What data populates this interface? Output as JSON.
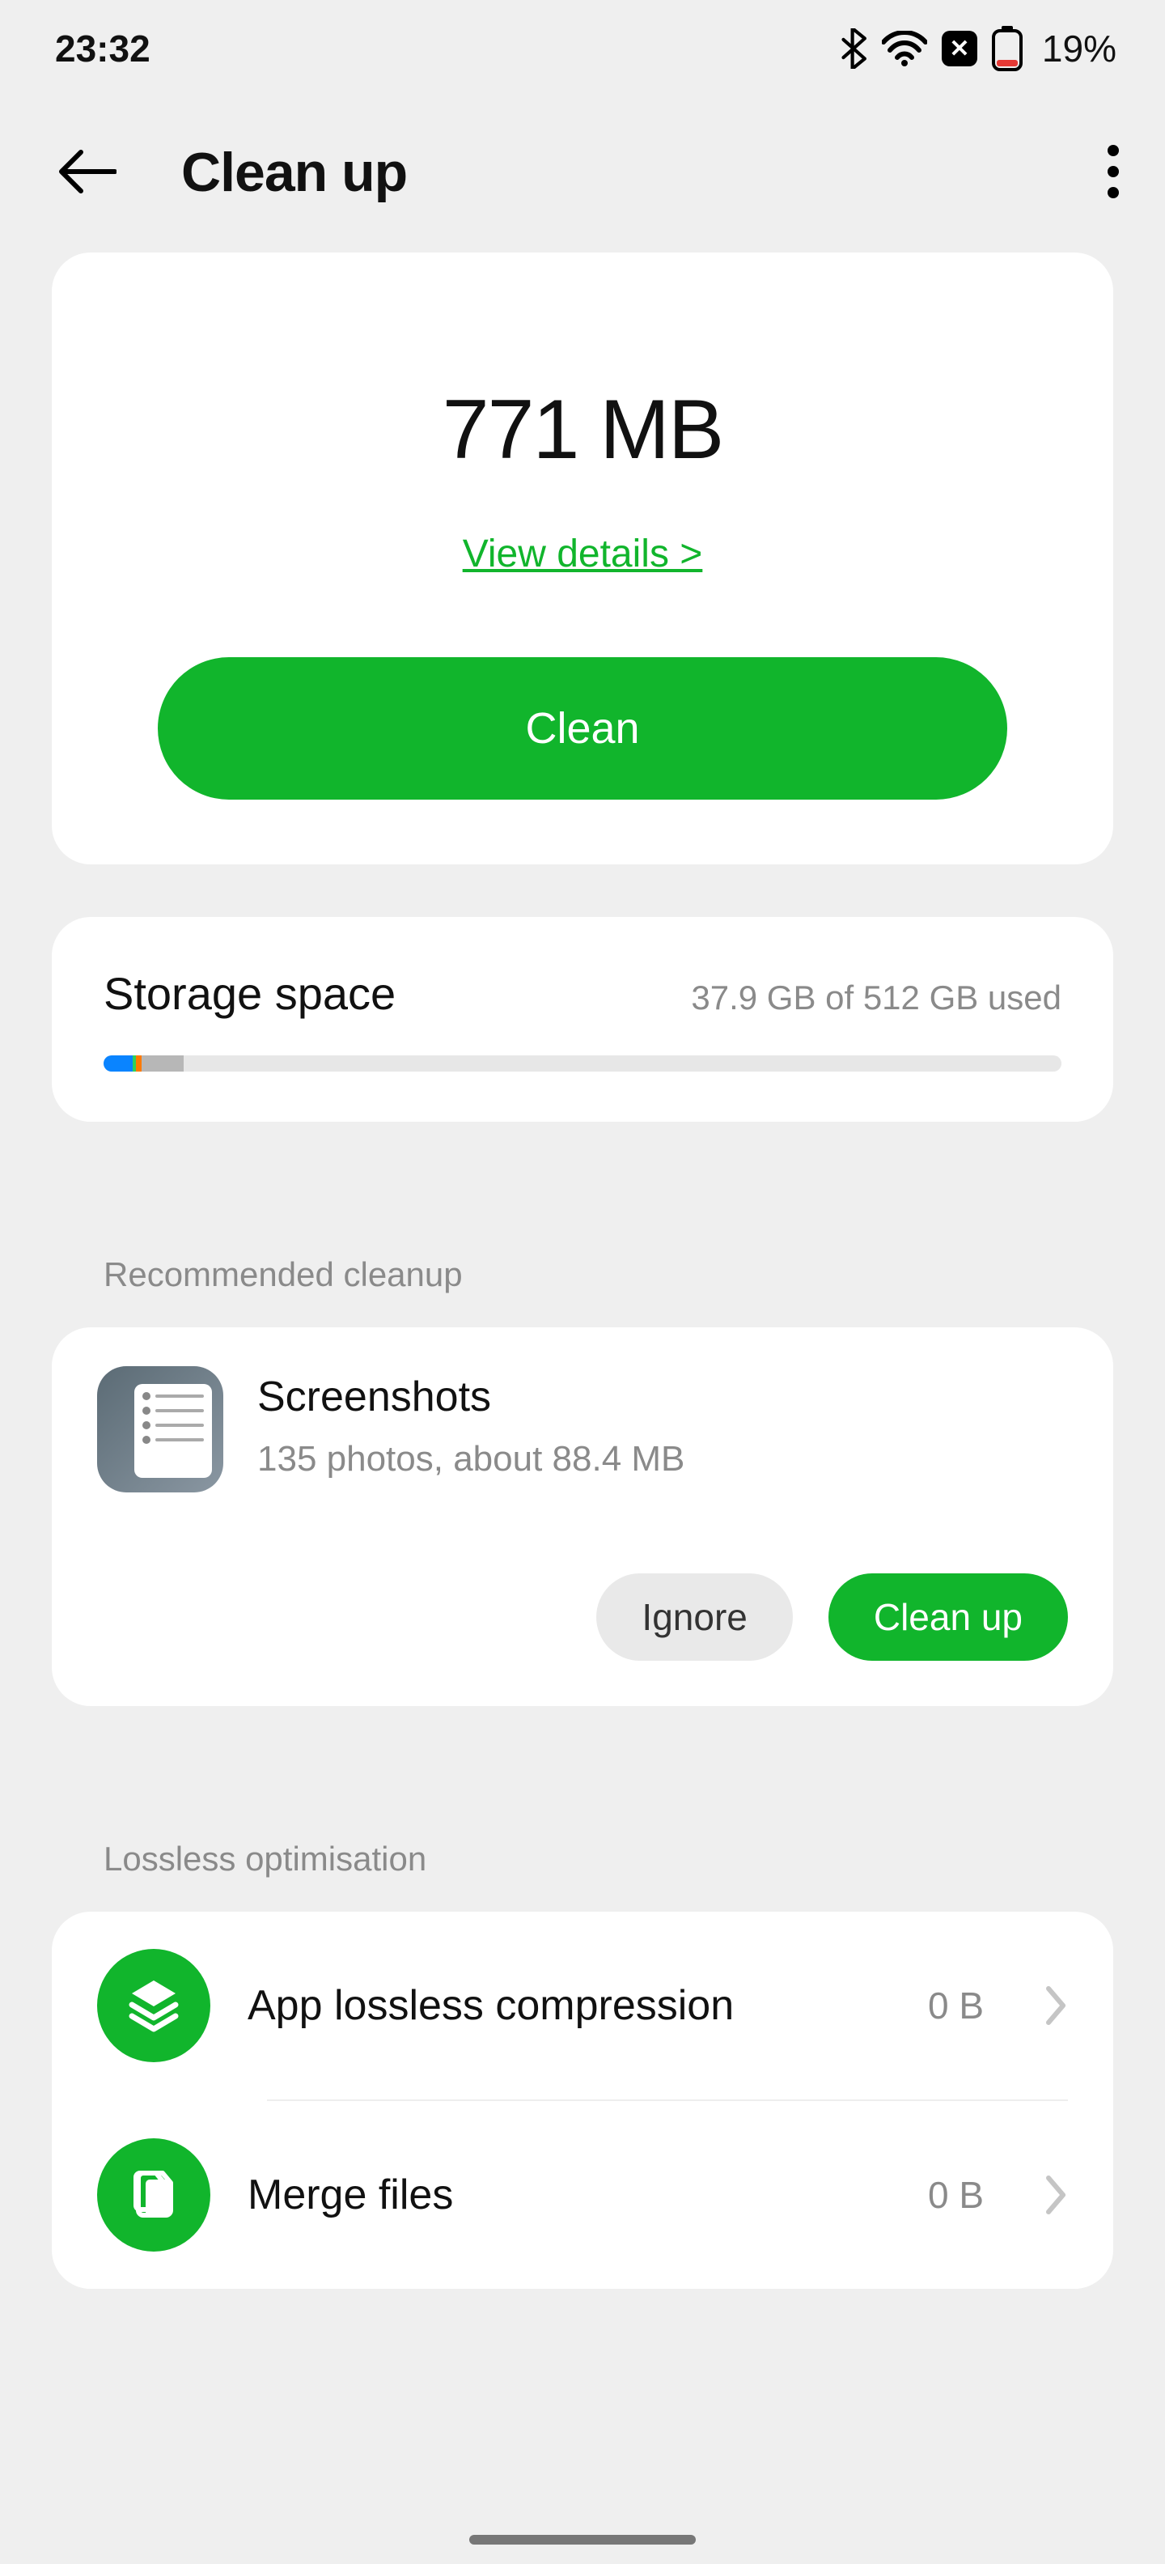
{
  "status": {
    "time": "23:32",
    "battery_pct": "19%"
  },
  "header": {
    "title": "Clean up"
  },
  "clean": {
    "size": "771 MB",
    "view_details": "View details >",
    "button": "Clean"
  },
  "storage": {
    "title": "Storage space",
    "usage_text": "37.9 GB of 512 GB used",
    "segments": [
      {
        "color": "#0a84ff",
        "start": 0,
        "width": 3.0
      },
      {
        "color": "#2fd15a",
        "start": 3.0,
        "width": 0.4
      },
      {
        "color": "#ff7a00",
        "start": 3.4,
        "width": 0.6
      },
      {
        "color": "#b7b7b7",
        "start": 4.0,
        "width": 4.4
      }
    ]
  },
  "sections": {
    "recommended_label": "Recommended cleanup",
    "lossless_label": "Lossless optimisation"
  },
  "recommended": {
    "title": "Screenshots",
    "subtitle": "135 photos, about 88.4 MB",
    "ignore": "Ignore",
    "cleanup": "Clean up"
  },
  "lossless": {
    "items": [
      {
        "title": "App lossless compression",
        "value": "0 B",
        "icon": "layers"
      },
      {
        "title": "Merge files",
        "value": "0 B",
        "icon": "files"
      }
    ]
  }
}
